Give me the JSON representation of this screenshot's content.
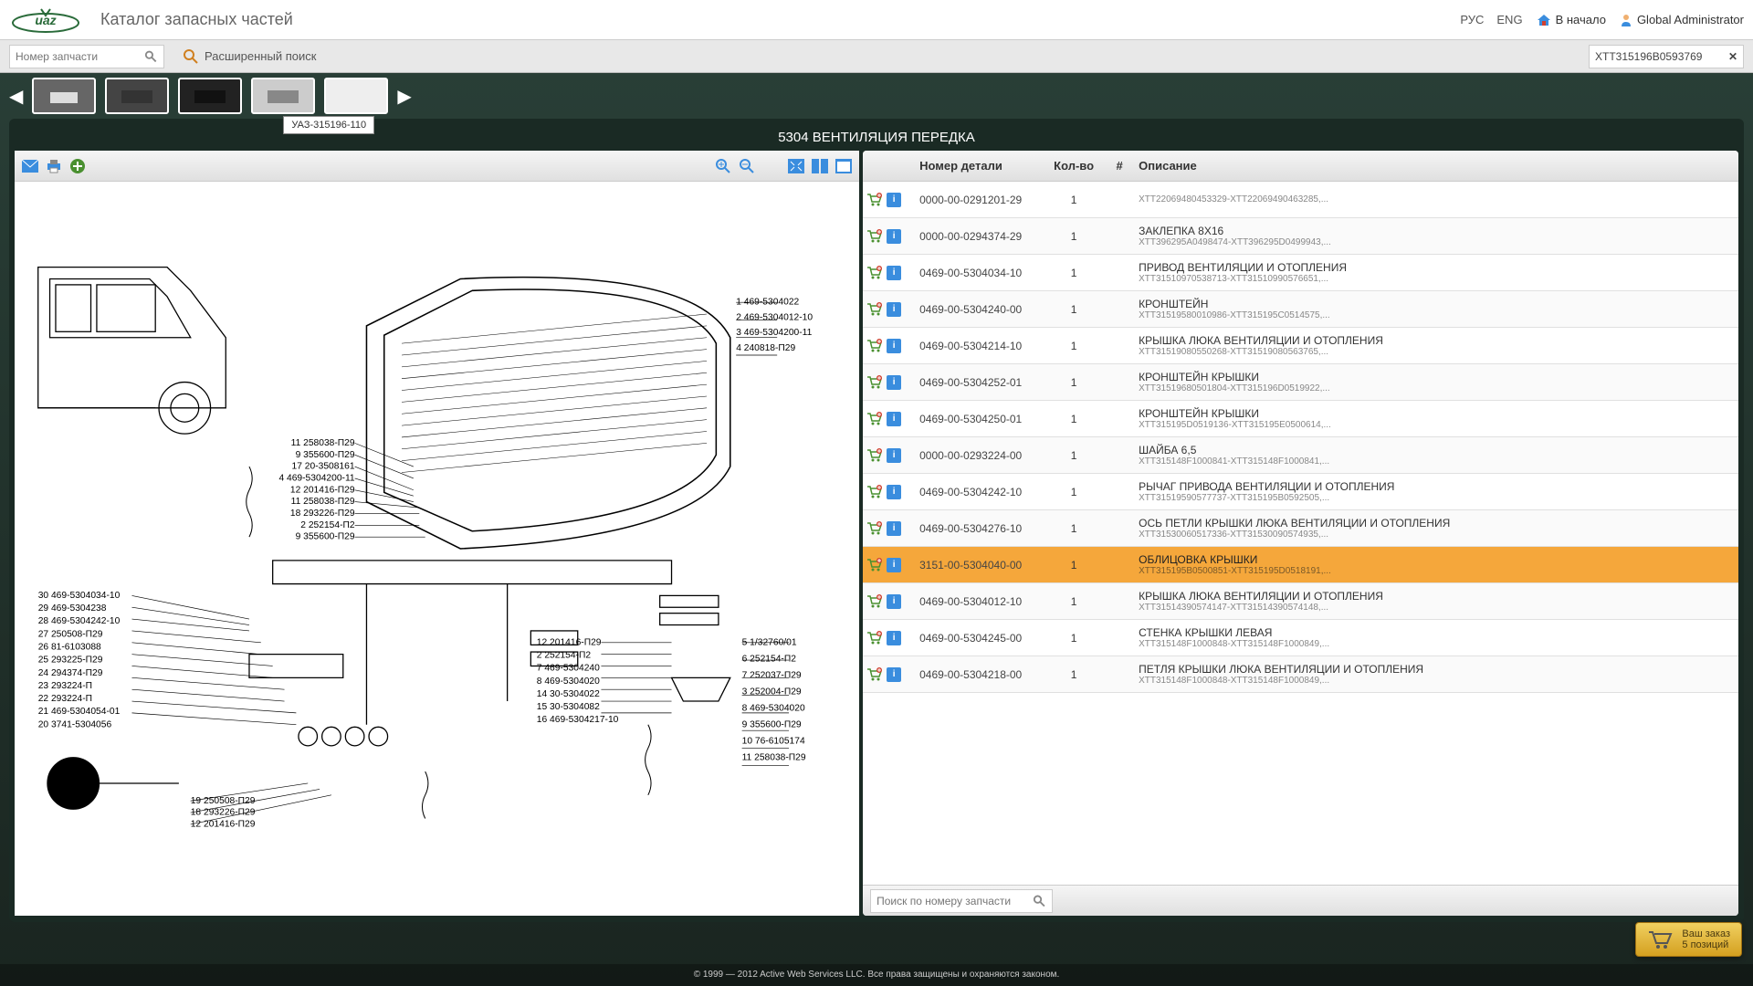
{
  "header": {
    "app_title": "Каталог запасных частей",
    "lang_ru": "РУС",
    "lang_en": "ENG",
    "home": "В начало",
    "user": "Global Administrator"
  },
  "search": {
    "placeholder": "Номер запчасти",
    "advanced": "Расширенный поиск",
    "vin": "XTT315196B0593769"
  },
  "breadcrumb": {
    "tooltip": "УАЗ-315196-110"
  },
  "panel": {
    "title": "5304 ВЕНТИЛЯЦИЯ ПЕРЕДКА"
  },
  "table": {
    "col_num": "Номер детали",
    "col_qty": "Кол-во",
    "col_hash": "#",
    "col_desc": "Описание",
    "search_placeholder": "Поиск по номеру запчасти",
    "rows": [
      {
        "num": "0000-00-0291201-29",
        "qty": "1",
        "desc": "",
        "sub": "XTT22069480453329-XTT22069490463285,..."
      },
      {
        "num": "0000-00-0294374-29",
        "qty": "1",
        "desc": "ЗАКЛЕПКА 8X16",
        "sub": "XTT396295A0498474-XTT396295D0499943,..."
      },
      {
        "num": "0469-00-5304034-10",
        "qty": "1",
        "desc": "ПРИВОД ВЕНТИЛЯЦИИ И ОТОПЛЕНИЯ",
        "sub": "XTT31510970538713-XTT31510990576651,..."
      },
      {
        "num": "0469-00-5304240-00",
        "qty": "1",
        "desc": "КРОНШТЕЙН",
        "sub": "XTT31519580010986-XTT315195C0514575,..."
      },
      {
        "num": "0469-00-5304214-10",
        "qty": "1",
        "desc": "КРЫШКА ЛЮКА ВЕНТИЛЯЦИИ И ОТОПЛЕНИЯ",
        "sub": "XTT31519080550268-XTT31519080563765,..."
      },
      {
        "num": "0469-00-5304252-01",
        "qty": "1",
        "desc": "КРОНШТЕЙН КРЫШКИ",
        "sub": "XTT31519680501804-XTT315196D0519922,..."
      },
      {
        "num": "0469-00-5304250-01",
        "qty": "1",
        "desc": "КРОНШТЕЙН КРЫШКИ",
        "sub": "XTT315195D0519136-XTT315195E0500614,..."
      },
      {
        "num": "0000-00-0293224-00",
        "qty": "1",
        "desc": "ШАЙБА 6,5",
        "sub": "XTT315148F1000841-XTT315148F1000841,..."
      },
      {
        "num": "0469-00-5304242-10",
        "qty": "1",
        "desc": "РЫЧАГ ПРИВОДА ВЕНТИЛЯЦИИ И ОТОПЛЕНИЯ",
        "sub": "XTT31519590577737-XTT315195B0592505,..."
      },
      {
        "num": "0469-00-5304276-10",
        "qty": "1",
        "desc": "ОСЬ ПЕТЛИ КРЫШКИ ЛЮКА ВЕНТИЛЯЦИИ И ОТОПЛЕНИЯ",
        "sub": "XTT31530060517336-XTT31530090574935,..."
      },
      {
        "num": "3151-00-5304040-00",
        "qty": "1",
        "desc": "ОБЛИЦОВКА КРЫШКИ",
        "sub": "XTT315195B0500851-XTT315195D0518191,...",
        "selected": true
      },
      {
        "num": "0469-00-5304012-10",
        "qty": "1",
        "desc": "КРЫШКА ЛЮКА ВЕНТИЛЯЦИИ И ОТОПЛЕНИЯ",
        "sub": "XTT31514390574147-XTT31514390574148,..."
      },
      {
        "num": "0469-00-5304245-00",
        "qty": "1",
        "desc": "СТЕНКА КРЫШКИ ЛЕВАЯ",
        "sub": "XTT315148F1000848-XTT315148F1000849,..."
      },
      {
        "num": "0469-00-5304218-00",
        "qty": "1",
        "desc": "ПЕТЛЯ КРЫШКИ ЛЮКА ВЕНТИЛЯЦИИ И ОТОПЛЕНИЯ",
        "sub": "XTT315148F1000848-XTT315148F1000849,..."
      }
    ]
  },
  "diagram": {
    "left_labels": [
      {
        "n": "30",
        "p": "469-5304034-10"
      },
      {
        "n": "29",
        "p": "469-5304238"
      },
      {
        "n": "28",
        "p": "469-5304242-10"
      },
      {
        "n": "27",
        "p": "250508-П29"
      },
      {
        "n": "26",
        "p": "81-6103088"
      },
      {
        "n": "25",
        "p": "293225-П29"
      },
      {
        "n": "24",
        "p": "294374-П29"
      },
      {
        "n": "23",
        "p": "293224-П"
      },
      {
        "n": "22",
        "p": "293224-П"
      },
      {
        "n": "21",
        "p": "469-5304054-01"
      },
      {
        "n": "20",
        "p": "3741-5304056"
      }
    ],
    "left_labels2": [
      {
        "n": "19",
        "p": "250508-П29"
      },
      {
        "n": "18",
        "p": "293226-П29"
      },
      {
        "n": "12",
        "p": "201416-П29"
      }
    ],
    "top_labels": [
      {
        "n": "11",
        "p": "258038-П29"
      },
      {
        "n": "9",
        "p": "355600-П29"
      },
      {
        "n": "17",
        "p": "20-3508161"
      },
      {
        "n": "4",
        "p": "469-5304200-11"
      },
      {
        "n": "12",
        "p": "201416-П29"
      },
      {
        "n": "11",
        "p": "258038-П29"
      },
      {
        "n": "18",
        "p": "293226-П29"
      },
      {
        "n": "2",
        "p": "252154-П2"
      },
      {
        "n": "9",
        "p": "355600-П29"
      }
    ],
    "right_top": [
      {
        "n": "1",
        "p": "469-5304022"
      },
      {
        "n": "2",
        "p": "469-5304012-10"
      },
      {
        "n": "3",
        "p": "469-5304200-11"
      },
      {
        "n": "4",
        "p": "240818-П29"
      }
    ],
    "right_mid": [
      {
        "n": "12",
        "p": "201416-П29"
      },
      {
        "n": "2",
        "p": "252154-П2"
      },
      {
        "n": "7",
        "p": "469-5304240"
      },
      {
        "n": "8",
        "p": "469-5304020"
      },
      {
        "n": "14",
        "p": "30-5304022"
      },
      {
        "n": "15",
        "p": "30-5304082"
      },
      {
        "n": "16",
        "p": "469-5304217-10"
      }
    ],
    "right_bot": [
      {
        "n": "5",
        "p": "1/32760/01"
      },
      {
        "n": "6",
        "p": "252154-П2"
      },
      {
        "n": "7",
        "p": "252037-П29"
      },
      {
        "n": "3",
        "p": "252004-П29"
      },
      {
        "n": "8",
        "p": "469-5304020"
      },
      {
        "n": "9",
        "p": "355600-П29"
      },
      {
        "n": "10",
        "p": "76-6105174"
      },
      {
        "n": "11",
        "p": "258038-П29"
      }
    ]
  },
  "order": {
    "title": "Ваш заказ",
    "count": "5 позиций"
  },
  "footer": "© 1999 — 2012 Active Web Services LLC. Все права защищены и охраняются законом."
}
